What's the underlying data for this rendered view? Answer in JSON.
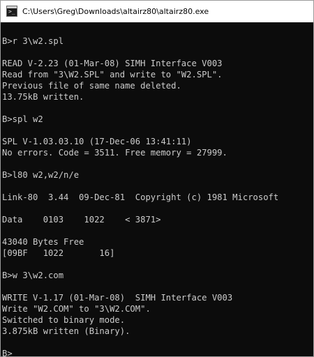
{
  "window": {
    "title": "C:\\Users\\Greg\\Downloads\\altairz80\\altairz80.exe",
    "icon": "console-app-icon"
  },
  "console": {
    "lines": [
      "",
      "B>r 3\\w2.spl",
      "",
      "READ V-2.23 (01-Mar-08) SIMH Interface V003",
      "Read from \"3\\W2.SPL\" and write to \"W2.SPL\".",
      "Previous file of same name deleted.",
      "13.75kB written.",
      "",
      "B>spl w2",
      "",
      "SPL V-1.03.03.10 (17-Dec-06 13:41:11)",
      "No errors. Code = 3511. Free memory = 27999.",
      "",
      "B>l80 w2,w2/n/e",
      "",
      "Link-80  3.44  09-Dec-81  Copyright (c) 1981 Microsoft",
      "",
      "Data    0103    1022    < 3871>",
      "",
      "43040 Bytes Free",
      "[09BF   1022       16]",
      "",
      "B>w 3\\w2.com",
      "",
      "WRITE V-1.17 (01-Mar-08)  SIMH Interface V003",
      "Write \"W2.COM\" to \"3\\W2.COM\".",
      "Switched to binary mode.",
      "3.875kB written (Binary).",
      "",
      "B>"
    ]
  }
}
